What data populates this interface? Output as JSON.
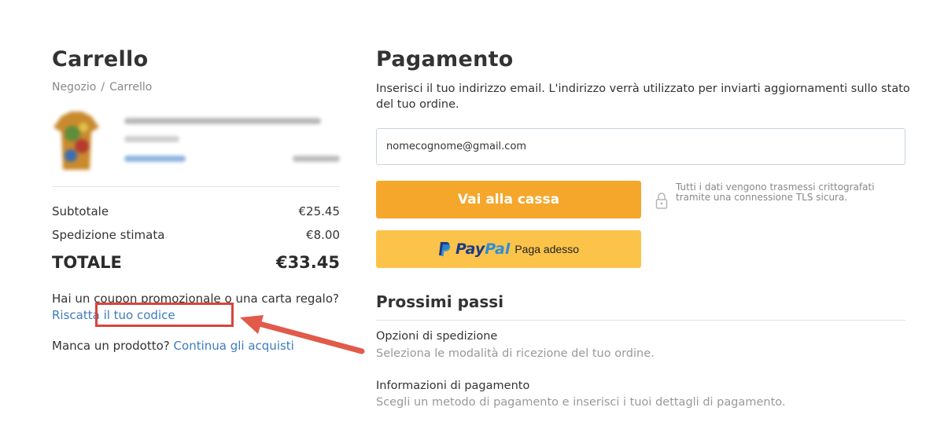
{
  "cart": {
    "title": "Carrello",
    "breadcrumb": [
      "Negozio",
      "Carrello"
    ],
    "breadcrumb_separator": "/",
    "subtotal_label": "Subtotale",
    "subtotal_value": "€25.45",
    "shipping_label": "Spedizione stimata",
    "shipping_value": "€8.00",
    "total_label": "TOTALE",
    "total_value": "€33.45",
    "coupon_text": "Hai un coupon promozionale o una carta regalo?",
    "coupon_link": "Riscatta il tuo codice",
    "missing_text": "Manca un prodotto?",
    "missing_link": "Continua gli acquisti"
  },
  "payment": {
    "title": "Pagamento",
    "description": "Inserisci il tuo indirizzo email. L'indirizzo verrà utilizzato per inviarti aggiornamenti sullo stato del tuo ordine.",
    "email_value": "nomecognome@gmail.com",
    "checkout_label": "Vai alla cassa",
    "paypal_brand_1": "Pay",
    "paypal_brand_2": "Pal",
    "paypal_label": "Paga adesso",
    "secure_text": "Tutti i dati vengono trasmessi crittografati tramite una connessione TLS sicura."
  },
  "next_steps": {
    "title": "Prossimi passi",
    "steps": [
      {
        "title": "Opzioni di spedizione",
        "desc": "Seleziona le modalità di ricezione del tuo ordine."
      },
      {
        "title": "Informazioni di pagamento",
        "desc": "Scegli un metodo di pagamento e inserisci i tuoi dettagli di pagamento."
      }
    ]
  },
  "colors": {
    "accent_orange": "#f5a72c",
    "paypal_yellow": "#fcc34a",
    "link_blue": "#3d7bbf",
    "highlight_red": "#d9443a"
  },
  "icons": [
    "lock-icon",
    "paypal-logo-icon",
    "annotation-arrow-icon"
  ]
}
